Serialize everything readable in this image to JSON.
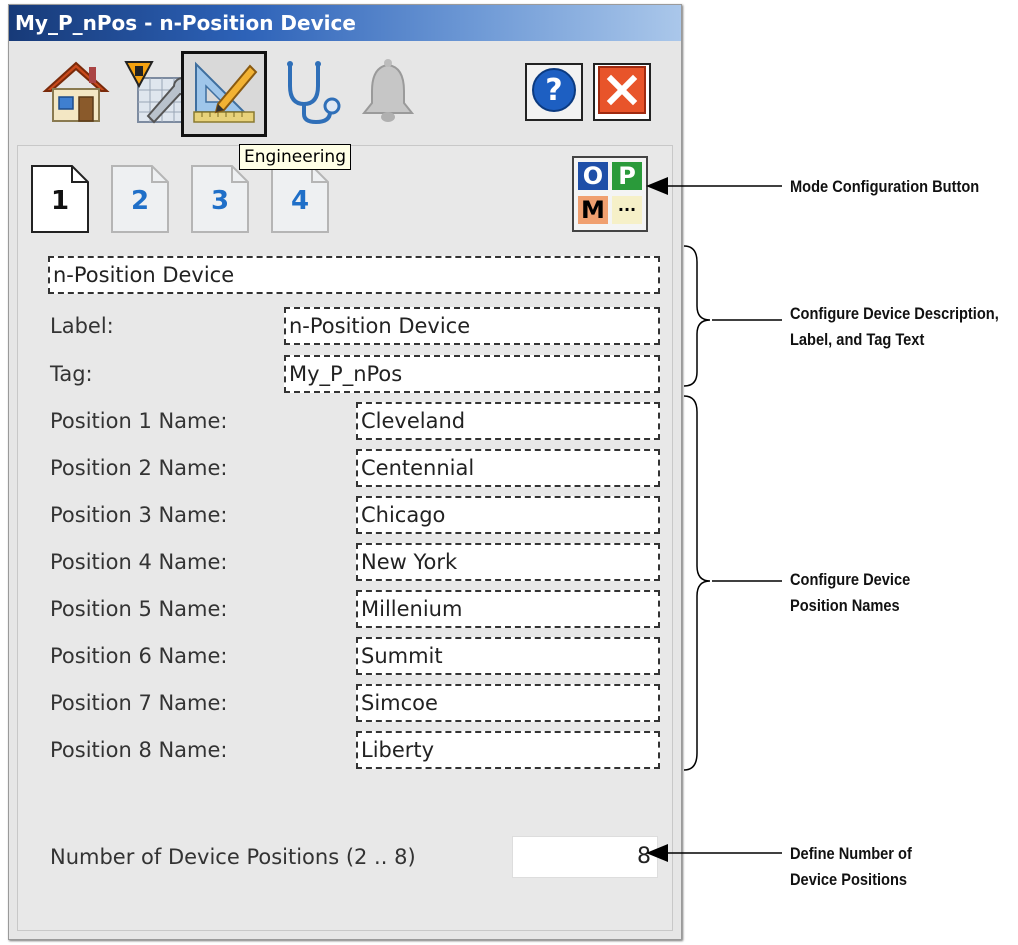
{
  "window": {
    "title": "My_P_nPos - n-Position Device",
    "tabs": [
      {
        "name": "home",
        "icon": "home-icon"
      },
      {
        "name": "maintenance",
        "icon": "maintenance-icon"
      },
      {
        "name": "engineering",
        "icon": "engineering-icon",
        "selected": true
      },
      {
        "name": "diagnostics",
        "icon": "stethoscope-icon"
      },
      {
        "name": "alarms",
        "icon": "bell-icon"
      }
    ],
    "help_icon": "help-icon",
    "close_icon": "close-icon",
    "tooltip": "Engineering"
  },
  "pages": [
    "1",
    "2",
    "3",
    "4"
  ],
  "active_page": "1",
  "mode_button": {
    "cells": [
      "O",
      "P",
      "M",
      "···"
    ]
  },
  "device": {
    "description": "n-Position Device",
    "label_caption": "Label:",
    "label_value": "n-Position Device",
    "tag_caption": "Tag:",
    "tag_value": "My_P_nPos"
  },
  "positions": [
    {
      "caption": "Position 1 Name:",
      "value": "Cleveland"
    },
    {
      "caption": "Position 2 Name:",
      "value": "Centennial"
    },
    {
      "caption": "Position 3 Name:",
      "value": "Chicago"
    },
    {
      "caption": "Position 4 Name:",
      "value": "New York"
    },
    {
      "caption": "Position 5 Name:",
      "value": "Millenium"
    },
    {
      "caption": "Position 6 Name:",
      "value": "Summit"
    },
    {
      "caption": "Position 7 Name:",
      "value": "Simcoe"
    },
    {
      "caption": "Position 8 Name:",
      "value": "Liberty"
    }
  ],
  "num_positions": {
    "caption": "Number of Device Positions (2 .. 8)",
    "value": "8"
  },
  "annotations": {
    "mode_config": "Mode Configuration Button",
    "desc_line1": "Configure Device Description,",
    "desc_line2": "Label, and Tag Text",
    "names_line1": "Configure Device",
    "names_line2": "Position Names",
    "num_line1": "Define Number of",
    "num_line2": "Device Positions"
  }
}
